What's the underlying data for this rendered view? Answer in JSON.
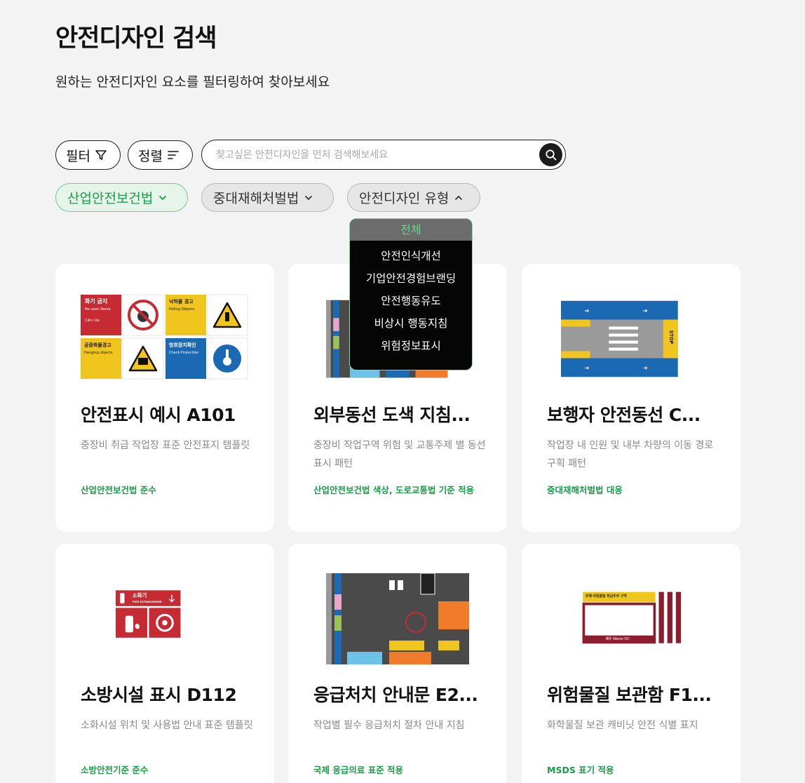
{
  "header": {
    "title": "안전디자인 검색",
    "subtitle": "원하는 안전디자인 요소를 필터링하여 찾아보세요"
  },
  "toolbar": {
    "filter_label": "필터",
    "sort_label": "정렬",
    "search_placeholder": "찾고싶은 안전디자인을 먼저 검색해보세요"
  },
  "chips": [
    {
      "label": "산업안전보건법",
      "active": true
    },
    {
      "label": "중대재해처벌법",
      "active": false
    },
    {
      "label": "안전디자인 유형",
      "active": false
    }
  ],
  "dropdown": {
    "selected": "전체",
    "options": [
      "안전인식개선",
      "기업안전경험브랜딩",
      "안전행동유도",
      "비상시 행동지침",
      "위험정보표시"
    ]
  },
  "thumb_text": {
    "sign1_title": "화기 금지",
    "sign1_sub": "No open flame",
    "sign1_sub2": "Cấm lửa",
    "sign2_title": "낙하물 경고",
    "sign2_sub": "Falling Objects",
    "sign3_title": "공중화물경고",
    "sign3_sub": "Hanging objects",
    "sign4_title": "방호장치확인",
    "sign4_sub": "Check Protection",
    "stop_text": "STOP",
    "fire_title": "소화기",
    "fire_sub": "FIRE EXTINGUISHER",
    "waste_label": "폐유  Waste Oil",
    "hazard_header": "유해·위험물질 취급주의 구역"
  },
  "cards": [
    {
      "title": "안전표시 예시 A101",
      "desc": "중장비 취급 작업장 표준 안전표지 템플릿",
      "tag": "산업안전보건법 준수"
    },
    {
      "title": "외부동선 도색 지침...",
      "desc": "중장비 작업구역 위험 및 교통주제 별 동선 표시 패턴",
      "tag": "산업안전보건법 색상, 도로교통법 기준 적용"
    },
    {
      "title": "보행자 안전동선 C...",
      "desc": "작업장 내 인원 및 내부 차량의 이동 경로 구획 패턴",
      "tag": "중대재해처벌법 대응"
    },
    {
      "title": "소방시설 표시 D112",
      "desc": "소화시설 위치 및 사용법 안내 표준 템플릿",
      "tag": "소방안전기준 준수"
    },
    {
      "title": "응급처치 안내문 E2...",
      "desc": "작업별 필수 응급처치 절차 안내 지침",
      "tag": "국제 응급의료 표준 적용"
    },
    {
      "title": "위험물질 보관함 F1...",
      "desc": "화학물질 보관 캐비닛 안전 식별 표지",
      "tag": "MSDS 표기 적용"
    }
  ],
  "colors": {
    "accent_green": "#1a9d48",
    "sign_red": "#c62b34",
    "sign_yellow": "#f0c51d",
    "sign_blue": "#1b69b3"
  }
}
